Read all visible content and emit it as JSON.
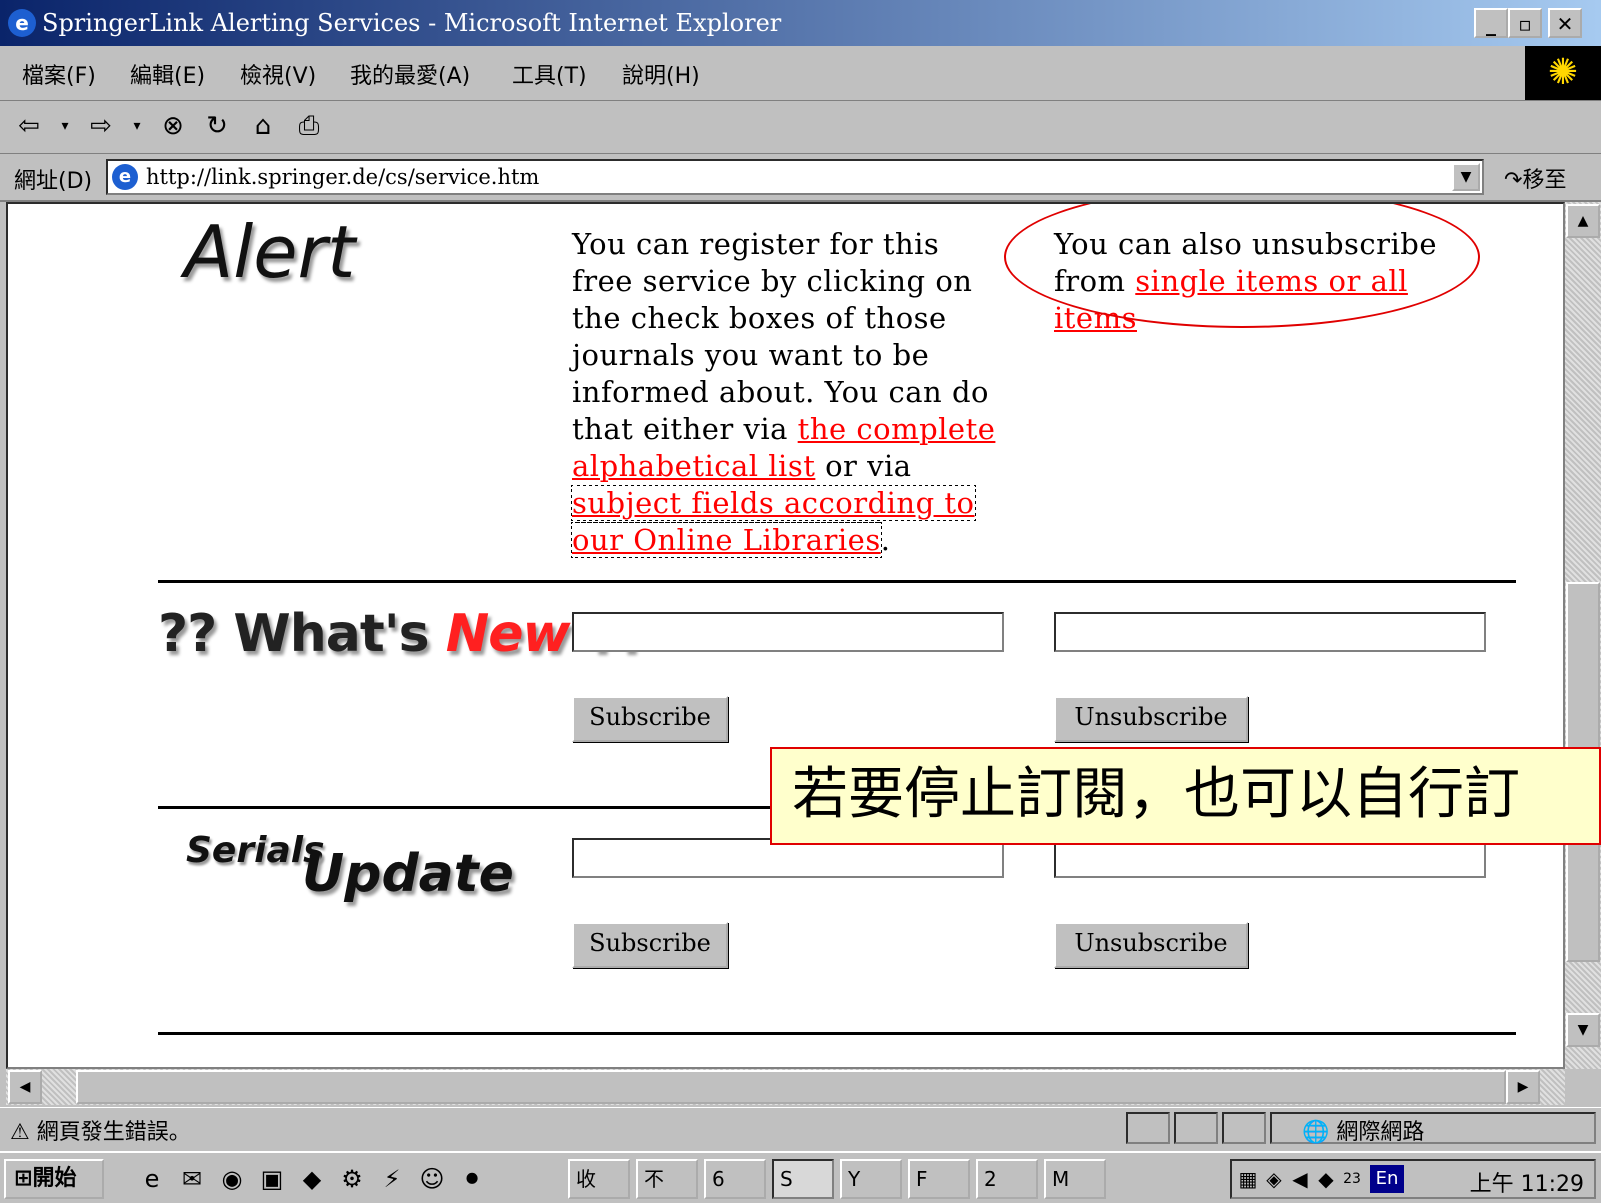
{
  "window": {
    "title": "SpringerLink Alerting Services - Microsoft Internet Explorer",
    "icon": "ie-icon"
  },
  "menu": [
    "檔案(F)",
    "編輯(E)",
    "檢視(V)",
    "我的最愛(A)",
    "工具(T)",
    "說明(H)"
  ],
  "address": {
    "label": "網址(D)",
    "url": "http://link.springer.de/cs/service.htm",
    "go_label": "移至"
  },
  "page": {
    "alert_logo": "Alert",
    "register_text": {
      "part1": "You can register for this free service by clicking on the check boxes of those journals you want to be informed about. You can do that either via ",
      "link1": "the complete alphabetical list",
      "part2": " or via ",
      "link2": "subject fields according to our Online Libraries",
      "part3": "."
    },
    "unsubscribe_text": {
      "part1": "You can also unsubscribe from ",
      "link": "single items or all items"
    },
    "whats_new": {
      "prefix": "?? What's ",
      "new_word": "New",
      "suffix": " ??"
    },
    "serials_word": "Serials",
    "update_word": "Update",
    "subscribe_label": "Subscribe",
    "unsubscribe_label": "Unsubscribe",
    "subscribe_input_value": "",
    "unsubscribe_input_value": ""
  },
  "overlay_caption": "若要停止訂閱，也可以自行訂",
  "status": {
    "text": "網頁發生錯誤。",
    "zone": "網際網路"
  },
  "taskbar": {
    "start_label": "開始",
    "tasks": [
      "收",
      "不",
      "6",
      "S",
      "Y",
      "F",
      "2",
      "M"
    ],
    "clock": "上午 11:29",
    "lang": "En",
    "date_badge": "23"
  },
  "colors": {
    "link": "#ff0000",
    "highlight_circle": "#e00000",
    "caption_bg": "#ffffcc"
  }
}
